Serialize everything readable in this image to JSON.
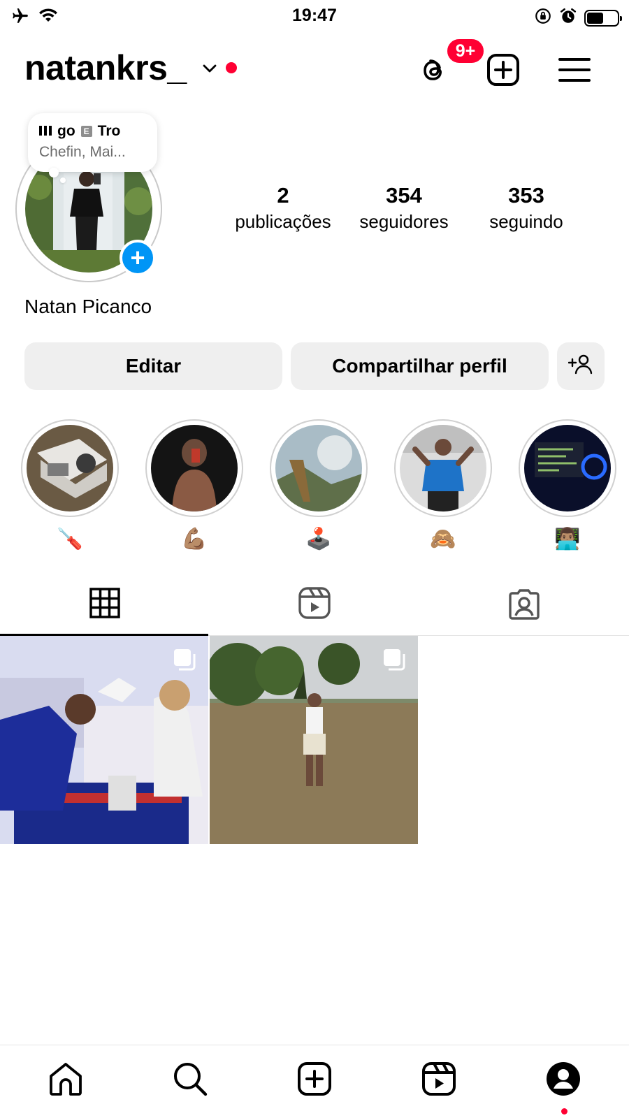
{
  "status_bar": {
    "time": "19:47",
    "battery_level": 0.55,
    "icons": [
      "airplane-icon",
      "wifi-icon",
      "orientation-lock-icon",
      "alarm-icon",
      "battery-icon"
    ]
  },
  "header": {
    "username": "natankrs_",
    "threads_badge": "9+",
    "icons": [
      "chevron-down-icon",
      "threads-icon",
      "create-post-icon",
      "menu-icon"
    ]
  },
  "note": {
    "line1_prefix": "go",
    "explicit_label": "E",
    "line1_suffix": "Tro",
    "line2": "Chefin, Mai..."
  },
  "profile": {
    "add_story_label": "+",
    "full_name": "Natan Picanco",
    "stats": [
      {
        "value": "2",
        "label": "publicações"
      },
      {
        "value": "354",
        "label": "seguidores"
      },
      {
        "value": "353",
        "label": "seguindo"
      }
    ]
  },
  "actions": {
    "edit_label": "Editar",
    "share_label": "Compartilhar perfil",
    "discover_icon": "add-person-icon"
  },
  "highlights": [
    {
      "emoji": "🪛"
    },
    {
      "emoji": "💪🏽"
    },
    {
      "emoji": "🕹️"
    },
    {
      "emoji": "🙈"
    },
    {
      "emoji": "👨🏽‍💻"
    }
  ],
  "tabs": [
    "grid-icon",
    "reels-icon",
    "tagged-icon"
  ],
  "posts_count_shown": 2,
  "bottom_nav": [
    "home-icon",
    "search-icon",
    "create-icon",
    "reels-icon",
    "profile-icon"
  ],
  "colors": {
    "accent_red": "#ff0033",
    "accent_blue": "#0095f6",
    "button_bg": "#efefef"
  }
}
